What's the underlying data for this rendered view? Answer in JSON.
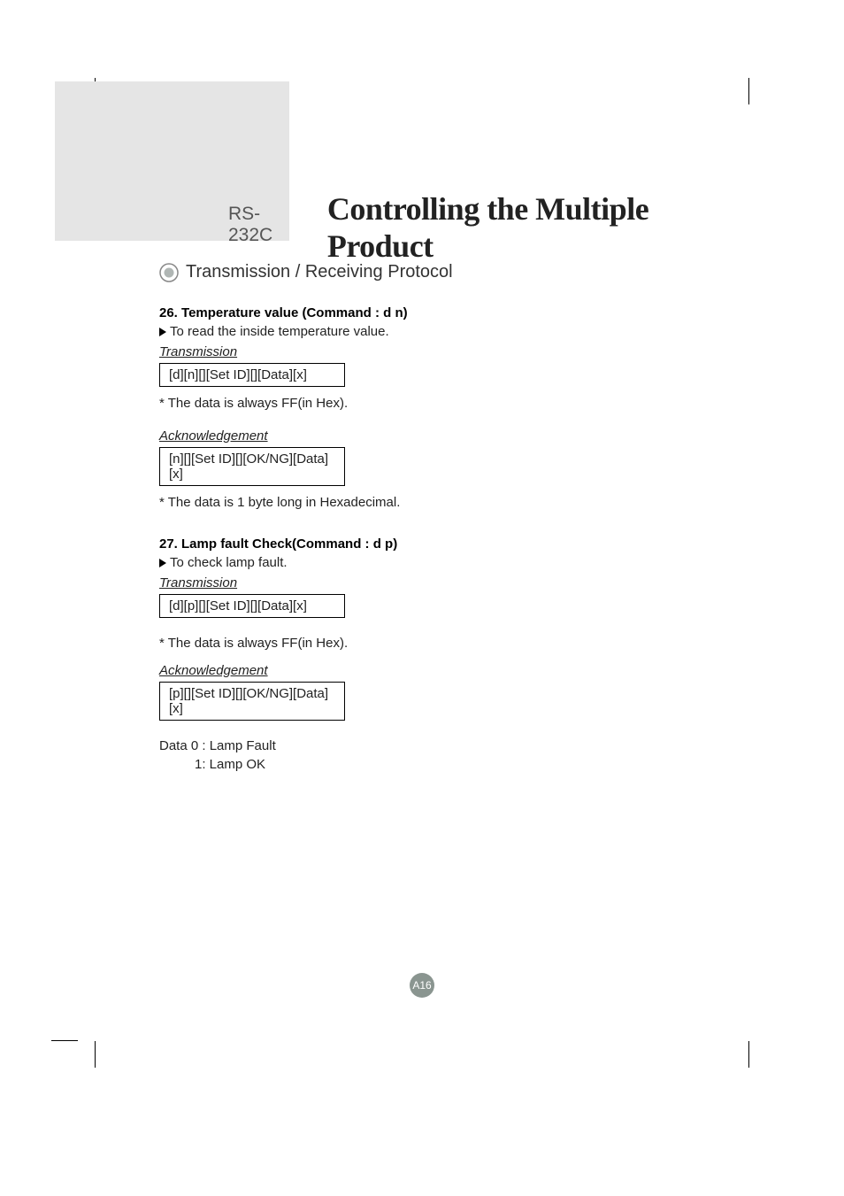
{
  "header": {
    "rs_label": "RS-232C",
    "main_title": "Controlling the Multiple Product"
  },
  "subheader": "Transmission / Receiving Protocol",
  "commands": [
    {
      "title": "26. Temperature value (Command : d n)",
      "desc": "To read the inside temperature value.",
      "tx_label": "Transmission",
      "tx_code": "[d][n][][Set ID][][Data][x]",
      "tx_note": "* The data is always FF(in Hex).",
      "ack_label": "Acknowledgement",
      "ack_code": "[n][][Set ID][][OK/NG][Data][x]",
      "ack_note": "* The data  is 1 byte long in Hexadecimal."
    },
    {
      "title": "27. Lamp fault Check(Command : d p)",
      "desc": "To check lamp fault.",
      "tx_label": "Transmission",
      "tx_code": "[d][p][][Set ID][][Data][x]",
      "tx_note": "* The data is always FF(in Hex).",
      "ack_label": "Acknowledgement",
      "ack_code": "[p][][Set ID][][OK/NG][Data][x]",
      "data_line1": "Data 0 : Lamp Fault",
      "data_line2": "1: Lamp OK"
    }
  ],
  "page_number": "A16"
}
